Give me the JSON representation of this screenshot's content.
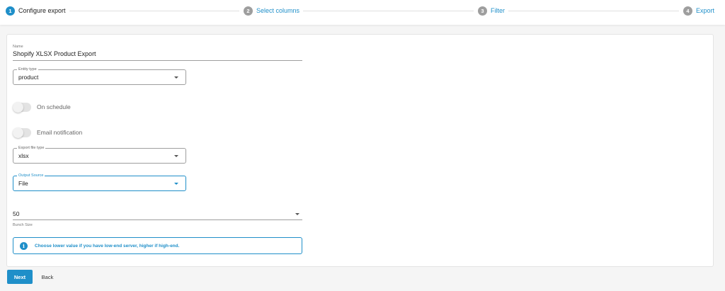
{
  "stepper": {
    "steps": [
      {
        "number": "1",
        "label": "Configure export"
      },
      {
        "number": "2",
        "label": "Select columns"
      },
      {
        "number": "3",
        "label": "Filter"
      },
      {
        "number": "4",
        "label": "Export"
      }
    ],
    "active_step": 1
  },
  "form": {
    "name": {
      "label": "Name",
      "value": "Shopify XLSX Product Export"
    },
    "entity_type": {
      "label": "Entity type",
      "value": "product"
    },
    "on_schedule": {
      "label": "On schedule",
      "enabled": false
    },
    "email_notification": {
      "label": "Email notification",
      "enabled": false
    },
    "export_file_type": {
      "label": "Export file type",
      "value": "xlsx"
    },
    "output_source": {
      "label": "Output Source",
      "value": "File"
    },
    "bunch_size": {
      "value": "50",
      "helper": "Bunch Size"
    },
    "info": {
      "icon": "info-icon",
      "text": "Choose lower value if you have low-end server, higher if high-end."
    }
  },
  "actions": {
    "next_label": "Next",
    "back_label": "Back"
  },
  "colors": {
    "accent": "#1f8fc9",
    "inactive_step": "#9e9e9e"
  }
}
